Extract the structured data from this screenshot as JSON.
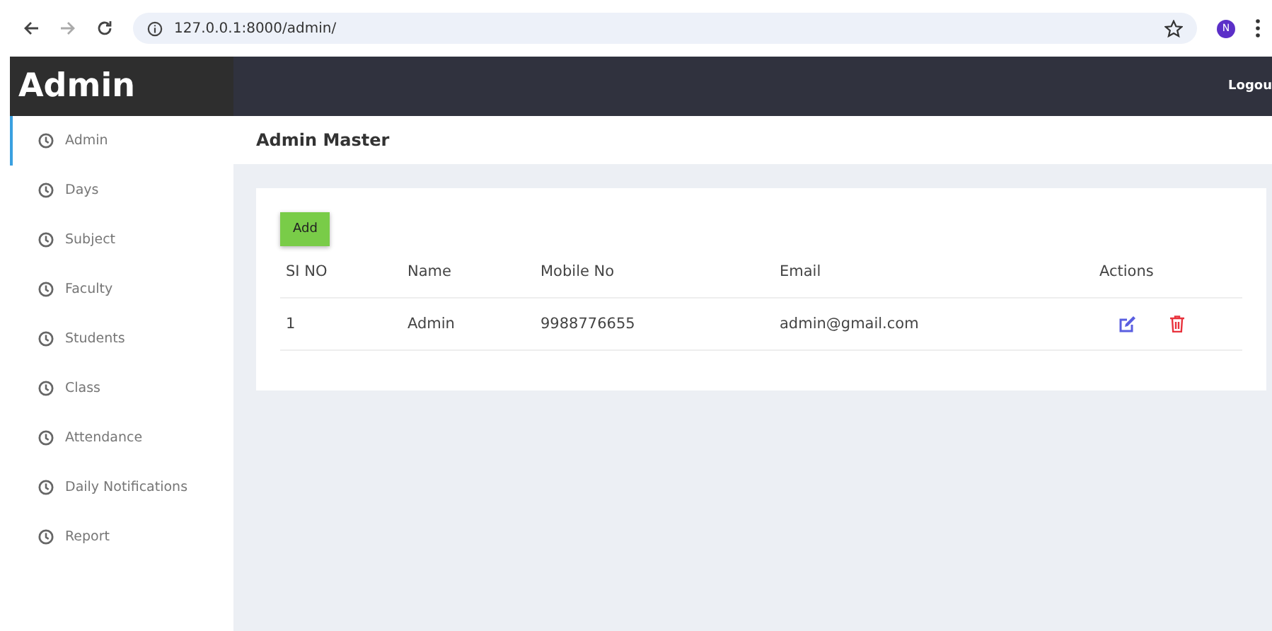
{
  "browser": {
    "url": "127.0.0.1:8000/admin/",
    "profile": "N"
  },
  "header": {
    "brand": "Admin",
    "logout": "Logou"
  },
  "sidebar": {
    "items": [
      {
        "label": "Admin",
        "selected": true
      },
      {
        "label": "Days",
        "selected": false
      },
      {
        "label": "Subject",
        "selected": false
      },
      {
        "label": "Faculty",
        "selected": false
      },
      {
        "label": "Students",
        "selected": false
      },
      {
        "label": "Class",
        "selected": false
      },
      {
        "label": "Attendance",
        "selected": false
      },
      {
        "label": "Daily Notifications",
        "selected": false
      },
      {
        "label": "Report",
        "selected": false
      }
    ]
  },
  "page_title": "Admin Master",
  "add_button": "Add",
  "table": {
    "columns": [
      "SI NO",
      "Name",
      "Mobile No",
      "Email",
      "Actions"
    ],
    "rows": [
      [
        "1",
        "Admin",
        "9988776655",
        "admin@gmail.com"
      ]
    ]
  }
}
